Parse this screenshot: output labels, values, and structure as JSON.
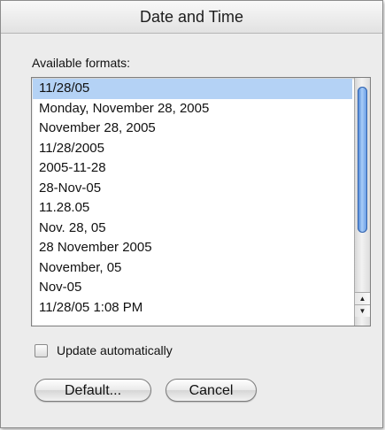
{
  "window": {
    "title": "Date and Time"
  },
  "formats": {
    "label": "Available formats:",
    "items": [
      "11/28/05",
      "Monday, November 28, 2005",
      "November 28, 2005",
      "11/28/2005",
      "2005-11-28",
      "28-Nov-05",
      "11.28.05",
      "Nov. 28, 05",
      "28 November 2005",
      "November, 05",
      "Nov-05",
      "11/28/05 1:08 PM"
    ],
    "selected": "11/28/05"
  },
  "update": {
    "label": "Update automatically",
    "checked": false
  },
  "buttons": {
    "default_label": "Default...",
    "cancel_label": "Cancel"
  },
  "icons": {
    "scroll_up": "▲",
    "scroll_down": "▼"
  },
  "colors": {
    "selection": "#b4d2f5",
    "scroll_thumb": "#5e95e2"
  }
}
